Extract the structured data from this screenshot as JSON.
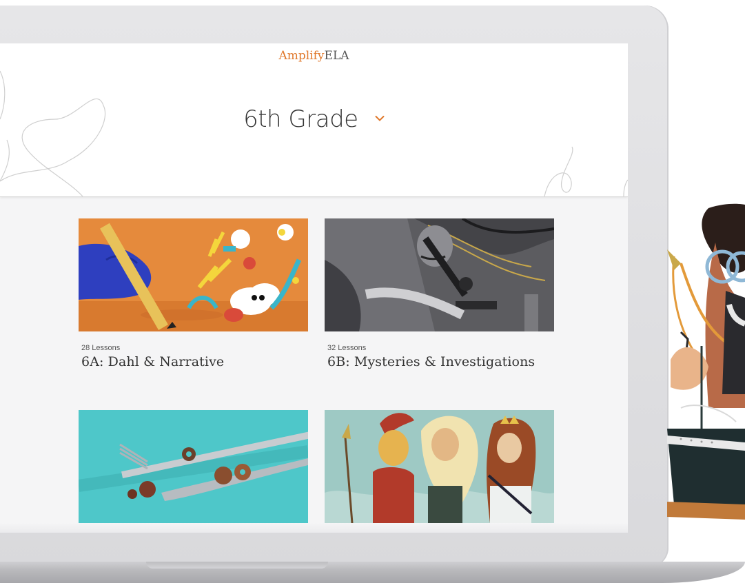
{
  "brand": {
    "accent": "Amplify",
    "rest": "ELA"
  },
  "grade_selector": {
    "label": "6th Grade",
    "icon": "chevron-down-icon"
  },
  "units": [
    {
      "lessons": "28 Lessons",
      "title": "6A: Dahl & Narrative",
      "image": "dahl-illustration"
    },
    {
      "lessons": "32 Lessons",
      "title": "6B: Mysteries & Investigations",
      "image": "detective-microscope-illustration"
    },
    {
      "lessons": "",
      "title": "",
      "image": "fork-knife-photo"
    },
    {
      "lessons": "",
      "title": "",
      "image": "greek-gods-illustration"
    }
  ],
  "colors": {
    "accent": "#e0782b",
    "text": "#333333",
    "screen_bg": "#f5f5f6"
  }
}
